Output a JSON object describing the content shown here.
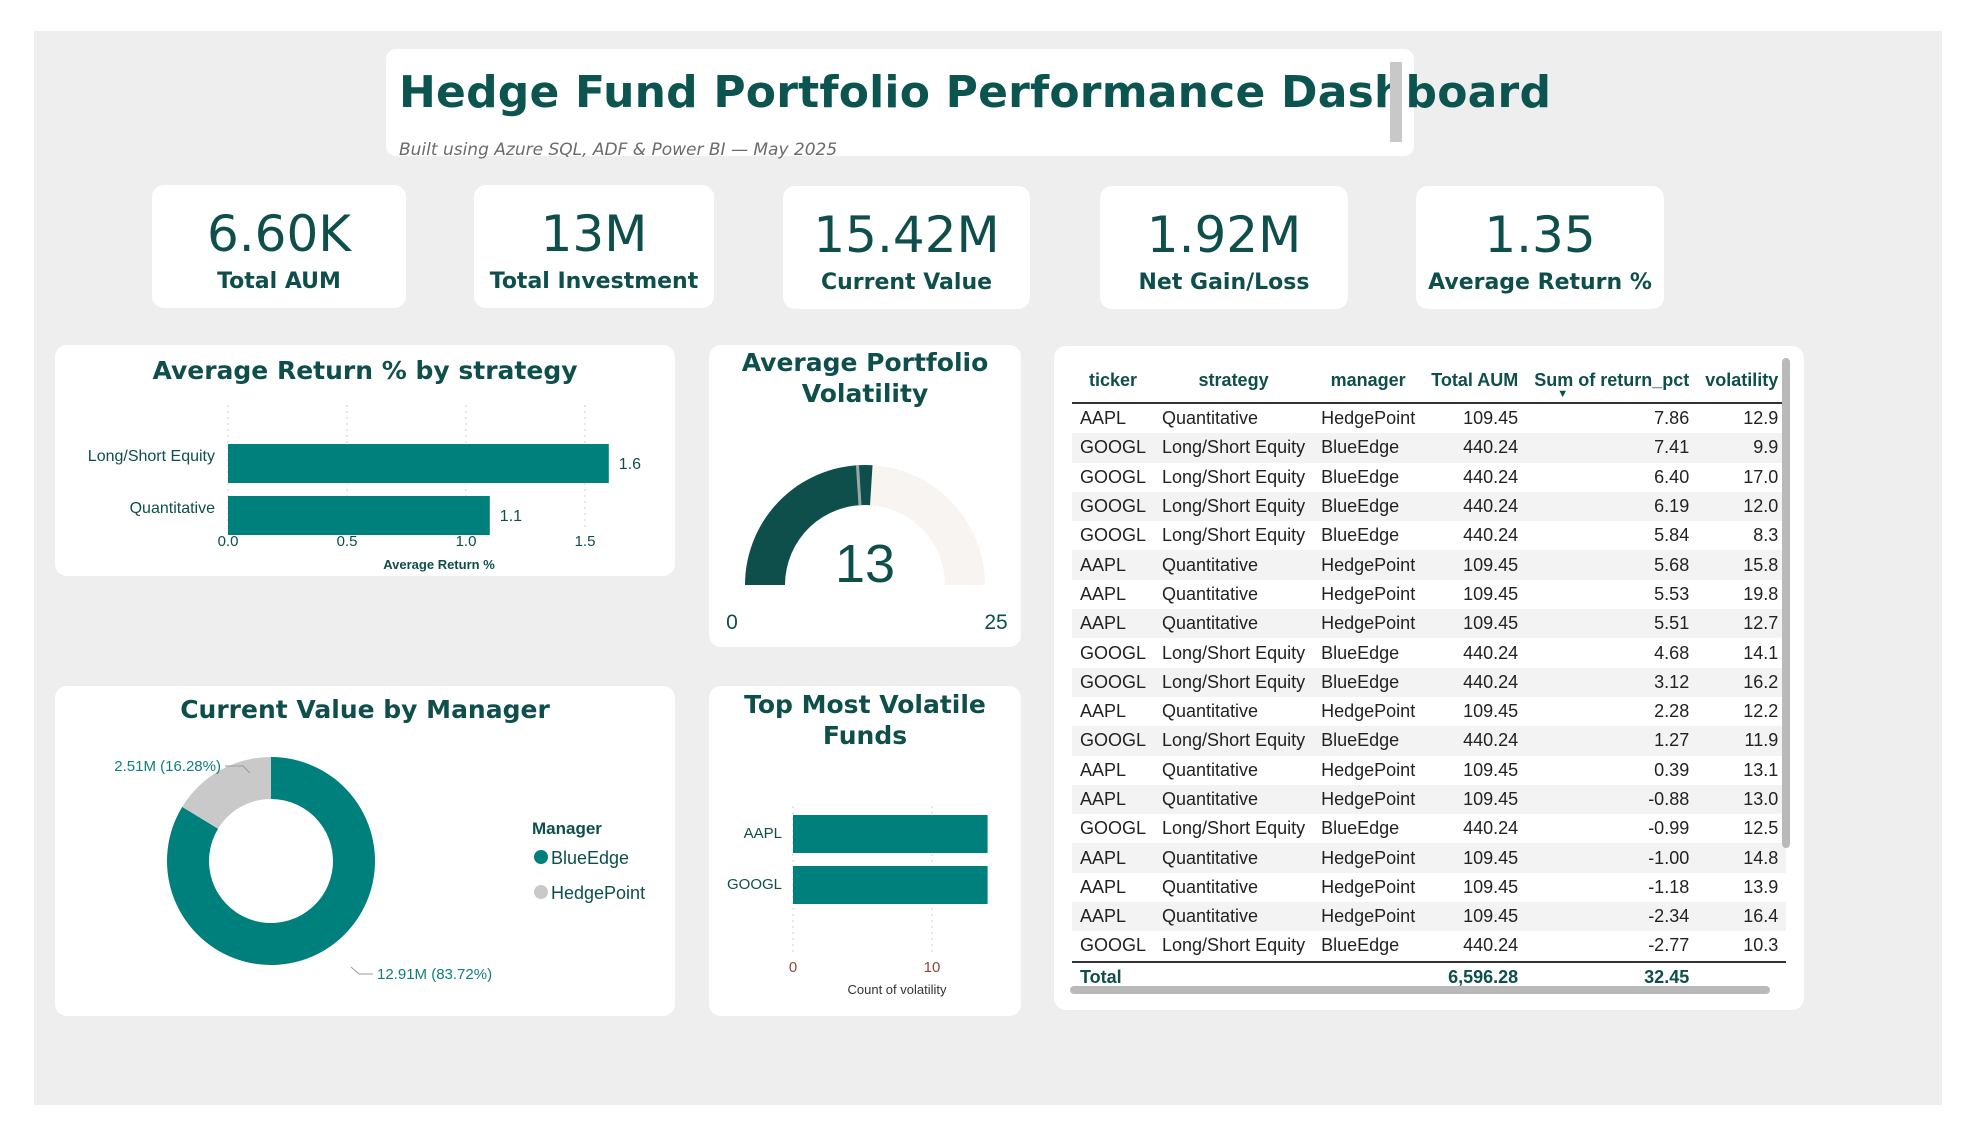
{
  "header": {
    "title": "Hedge Fund Portfolio Performance Dashboard",
    "subtitle": "Built using Azure SQL, ADF & Power BI — May 2025"
  },
  "kpis": [
    {
      "value": "6.60K",
      "label": "Total AUM"
    },
    {
      "value": "13M",
      "label": "Total Investment"
    },
    {
      "value": "15.42M",
      "label": "Current Value"
    },
    {
      "value": "1.92M",
      "label": "Net Gain/Loss"
    },
    {
      "value": "1.35",
      "label": "Average Return %"
    }
  ],
  "colors": {
    "teal": "#00807d",
    "dark_teal": "#0e4f4c",
    "grey": "#c9c9c9",
    "gauge_empty": "#f7f4f1"
  },
  "strategy_chart": {
    "title": "Average Return % by strategy",
    "xlabel": "Average Return %",
    "ticks": [
      "0.0",
      "0.5",
      "1.0",
      "1.5"
    ]
  },
  "gauge": {
    "title_line1": "Average Portfolio",
    "title_line2": "Volatility",
    "value_label": "13",
    "target_label": "12",
    "min_label": "0",
    "max_label": "25"
  },
  "donut": {
    "title": "Current Value by Manager",
    "legend_title": "Manager",
    "legend": [
      "BlueEdge",
      "HedgePoint"
    ],
    "label_blueedge": "12.91M (83.72%)",
    "label_hedgepoint": "2.51M (16.28%)"
  },
  "volatile_chart": {
    "title_line1": "Top Most Volatile",
    "title_line2": "Funds",
    "xlabel": "Count of volatility",
    "ticks": [
      "0",
      "10"
    ]
  },
  "chart_data": [
    {
      "type": "bar",
      "title": "Average Return % by strategy",
      "categories": [
        "Long/Short Equity",
        "Quantitative"
      ],
      "values": [
        1.6,
        1.1
      ],
      "xlabel": "Average Return %",
      "xlim": [
        0,
        1.5
      ]
    },
    {
      "type": "gauge",
      "title": "Average Portfolio Volatility",
      "value": 13,
      "target": 12,
      "min": 0,
      "max": 25
    },
    {
      "type": "pie",
      "title": "Current Value by Manager",
      "categories": [
        "BlueEdge",
        "HedgePoint"
      ],
      "values": [
        12.91,
        2.51
      ],
      "labels": [
        "12.91M (83.72%)",
        "2.51M (16.28%)"
      ]
    },
    {
      "type": "bar",
      "title": "Top Most Volatile Funds",
      "categories": [
        "AAPL",
        "GOOGL"
      ],
      "values": [
        14,
        14
      ],
      "xlabel": "Count of volatility",
      "xlim": [
        0,
        10
      ]
    }
  ],
  "table": {
    "columns": [
      "ticker",
      "strategy",
      "manager",
      "Total AUM",
      "Sum of return_pct",
      "volatility"
    ],
    "rows": [
      [
        "AAPL",
        "Quantitative",
        "HedgePoint",
        "109.45",
        "7.86",
        "12.9"
      ],
      [
        "GOOGL",
        "Long/Short Equity",
        "BlueEdge",
        "440.24",
        "7.41",
        "9.9"
      ],
      [
        "GOOGL",
        "Long/Short Equity",
        "BlueEdge",
        "440.24",
        "6.40",
        "17.0"
      ],
      [
        "GOOGL",
        "Long/Short Equity",
        "BlueEdge",
        "440.24",
        "6.19",
        "12.0"
      ],
      [
        "GOOGL",
        "Long/Short Equity",
        "BlueEdge",
        "440.24",
        "5.84",
        "8.3"
      ],
      [
        "AAPL",
        "Quantitative",
        "HedgePoint",
        "109.45",
        "5.68",
        "15.8"
      ],
      [
        "AAPL",
        "Quantitative",
        "HedgePoint",
        "109.45",
        "5.53",
        "19.8"
      ],
      [
        "AAPL",
        "Quantitative",
        "HedgePoint",
        "109.45",
        "5.51",
        "12.7"
      ],
      [
        "GOOGL",
        "Long/Short Equity",
        "BlueEdge",
        "440.24",
        "4.68",
        "14.1"
      ],
      [
        "GOOGL",
        "Long/Short Equity",
        "BlueEdge",
        "440.24",
        "3.12",
        "16.2"
      ],
      [
        "AAPL",
        "Quantitative",
        "HedgePoint",
        "109.45",
        "2.28",
        "12.2"
      ],
      [
        "GOOGL",
        "Long/Short Equity",
        "BlueEdge",
        "440.24",
        "1.27",
        "11.9"
      ],
      [
        "AAPL",
        "Quantitative",
        "HedgePoint",
        "109.45",
        "0.39",
        "13.1"
      ],
      [
        "AAPL",
        "Quantitative",
        "HedgePoint",
        "109.45",
        "-0.88",
        "13.0"
      ],
      [
        "GOOGL",
        "Long/Short Equity",
        "BlueEdge",
        "440.24",
        "-0.99",
        "12.5"
      ],
      [
        "AAPL",
        "Quantitative",
        "HedgePoint",
        "109.45",
        "-1.00",
        "14.8"
      ],
      [
        "AAPL",
        "Quantitative",
        "HedgePoint",
        "109.45",
        "-1.18",
        "13.9"
      ],
      [
        "AAPL",
        "Quantitative",
        "HedgePoint",
        "109.45",
        "-2.34",
        "16.4"
      ],
      [
        "GOOGL",
        "Long/Short Equity",
        "BlueEdge",
        "440.24",
        "-2.77",
        "10.3"
      ]
    ],
    "total": {
      "label": "Total",
      "aum": "6,596.28",
      "return": "32.45"
    }
  }
}
